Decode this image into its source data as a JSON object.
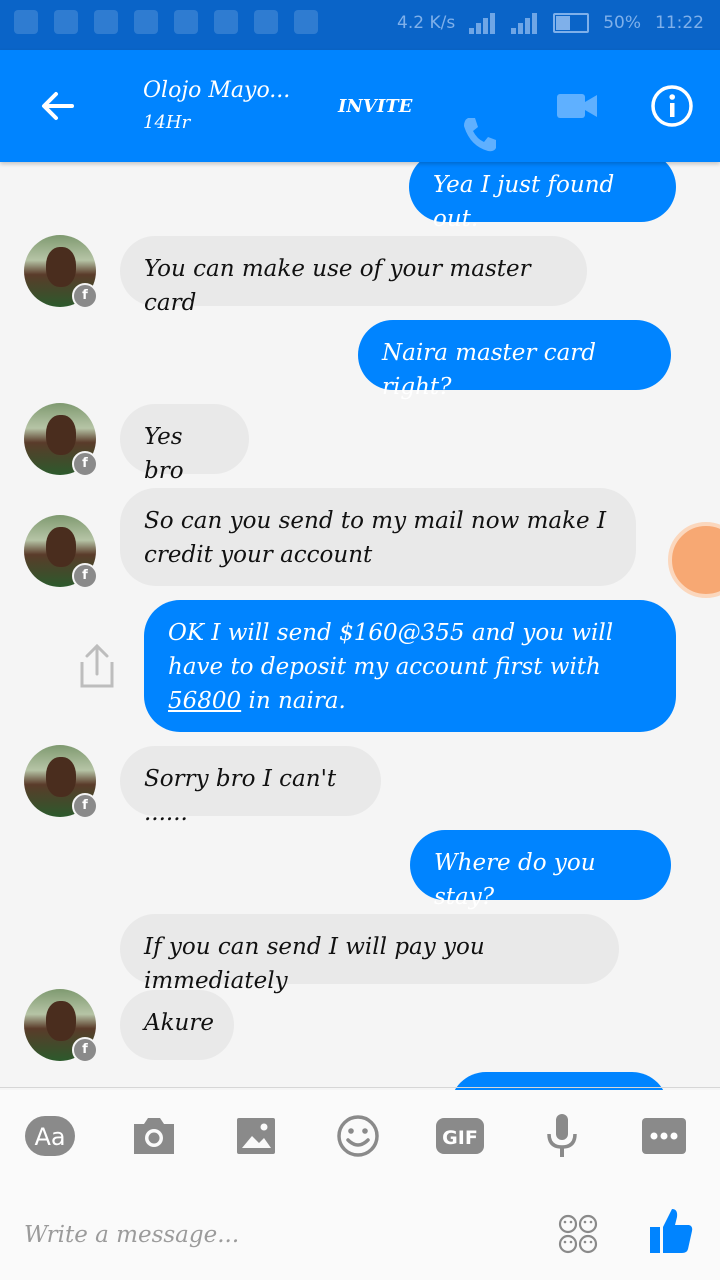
{
  "status_bar": {
    "network_speed": "4.2 K/s",
    "battery": "50%",
    "time": "11:22"
  },
  "header": {
    "contact_name": "Olojo Mayo...",
    "contact_status": "14Hr",
    "invite_label": "INVITE"
  },
  "messages": [
    {
      "direction": "out",
      "text": "Yea I just found out."
    },
    {
      "direction": "in",
      "text": "You can make use of your master card"
    },
    {
      "direction": "out",
      "text": "Naira master card right?"
    },
    {
      "direction": "in",
      "text": "Yes bro"
    },
    {
      "direction": "in",
      "text": "So can you send to my mail now make I credit your account"
    },
    {
      "direction": "out",
      "text_before": "OK I will send $160@355 and you will have to deposit my account first with ",
      "link": "56800",
      "text_after": " in naira."
    },
    {
      "direction": "in",
      "text": "Sorry bro I can't ......"
    },
    {
      "direction": "out",
      "text": "Where do you stay?"
    },
    {
      "direction": "in",
      "text": "If you can send I will pay you immediately"
    },
    {
      "direction": "in",
      "text": "Akure"
    }
  ],
  "composer": {
    "placeholder": "Write a message...",
    "text_tool_label": "Aa",
    "gif_label": "GIF"
  },
  "colors": {
    "accent": "#0084ff",
    "status_bar": "#0a64c8",
    "incoming_bubble": "#e9e9e9",
    "icon_gray": "#8a8a8a"
  },
  "icons": [
    "back-arrow-icon",
    "phone-icon",
    "video-camera-icon",
    "info-icon",
    "share-icon",
    "camera-icon",
    "image-icon",
    "emoji-icon",
    "microphone-icon",
    "more-icon",
    "stickers-icon",
    "thumbs-up-icon"
  ]
}
